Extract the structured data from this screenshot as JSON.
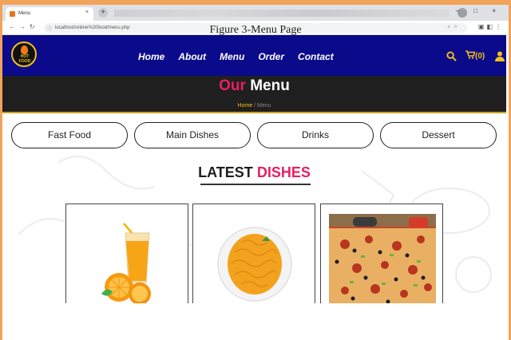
{
  "browser": {
    "tab_title": "Menu",
    "tab_close": "×",
    "new_tab": "+",
    "url": "localhost/online%20food/menu.php",
    "window_controls": "– □ ×"
  },
  "header": {
    "logo_text": "HOT FOOD",
    "nav": [
      "Home",
      "About",
      "Menu",
      "Order",
      "Contact"
    ],
    "cart_label": "(0)"
  },
  "hero": {
    "title_accent": "Our",
    "title_rest": "Menu",
    "breadcrumb_home": "Home",
    "breadcrumb_sep": "/",
    "breadcrumb_current": "Menu"
  },
  "categories": [
    "Fast Food",
    "Main Dishes",
    "Drinks",
    "Dessert"
  ],
  "section": {
    "title_dark": "LATEST",
    "title_accent": "DISHES"
  },
  "dishes": [
    {
      "icon": "orange-juice-image"
    },
    {
      "icon": "noodles-image"
    },
    {
      "icon": "pizza-image"
    }
  ],
  "caption": "Figure 3-Menu Page",
  "colors": {
    "nav_bg": "#0a0a8a",
    "accent_pink": "#e91e63",
    "accent_gold": "#f3c01a",
    "hero_bg": "#1f1f1f"
  }
}
